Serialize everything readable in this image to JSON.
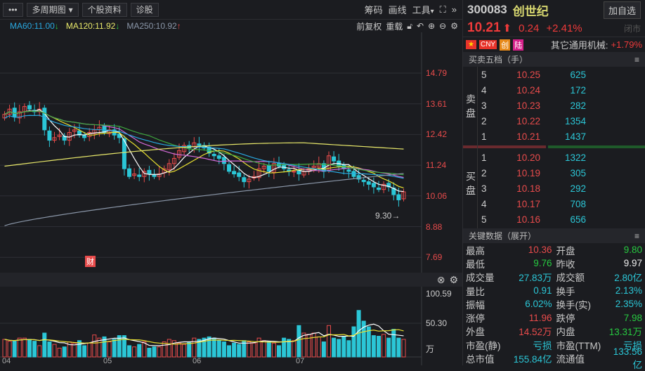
{
  "toolbar": {
    "more": "•••",
    "multi_period": "多周期图",
    "profile": "个股资料",
    "diagnose": "诊股",
    "chips": "筹码",
    "draw": "画线",
    "tools": "工具"
  },
  "ma_legend": [
    {
      "label": "MA60:11.00",
      "arrow": "↓",
      "color": "#29a8e0"
    },
    {
      "label": "MA120:11.92",
      "arrow": "↓",
      "color": "#e8e86a"
    },
    {
      "label": "MA250:10.92",
      "arrow": "↑",
      "color": "#8a96a8"
    }
  ],
  "chart_tools": {
    "adjust": "前复权",
    "reload": "重载"
  },
  "price_axis": [
    "14.79",
    "13.61",
    "12.42",
    "11.24",
    "10.06",
    "8.88",
    "7.69"
  ],
  "volume_axis": [
    "100.59",
    "50.30",
    "万"
  ],
  "date_axis": [
    "04",
    "05",
    "06",
    "07"
  ],
  "annotations": {
    "low_marker": "9.30→",
    "finance_badge": "财"
  },
  "chart_data": {
    "type": "candlestick",
    "closes": [
      13.2,
      13.4,
      13.1,
      13.3,
      13.5,
      13.4,
      13.3,
      13.4,
      12.6,
      12.2,
      12.3,
      12.4,
      12.2,
      12.5,
      12.6,
      12.4,
      12.3,
      12.5,
      12.6,
      12.7,
      12.5,
      12.6,
      12.4,
      12.3,
      11.1,
      10.8,
      10.9,
      10.8,
      11.0,
      10.9,
      10.8,
      10.9,
      11.1,
      11.3,
      11.5,
      11.8,
      12.0,
      11.9,
      12.1,
      12.0,
      11.9,
      11.7,
      11.6,
      11.5,
      11.3,
      11.0,
      10.9,
      10.8,
      10.6,
      10.7,
      10.8,
      11.1,
      11.2,
      11.0,
      11.3,
      11.2,
      11.1,
      11.0,
      11.0,
      10.9,
      11.0,
      11.1,
      11.2,
      11.3,
      11.0,
      11.6,
      11.4,
      11.2,
      11.1,
      11.0,
      10.8,
      10.7,
      10.6,
      10.5,
      10.4,
      10.3,
      10.5,
      10.4,
      10.1,
      9.9,
      10.21
    ],
    "volumes": [
      28,
      25,
      25,
      30,
      30,
      28,
      25,
      18,
      38,
      24,
      20,
      14,
      16,
      24,
      22,
      26,
      18,
      22,
      35,
      30,
      32,
      24,
      28,
      34,
      34,
      18,
      16,
      20,
      24,
      14,
      16,
      16,
      24,
      28,
      26,
      22,
      20,
      24,
      30,
      28,
      30,
      32,
      30,
      26,
      24,
      18,
      22,
      20,
      26,
      24,
      22,
      30,
      26,
      24,
      22,
      18,
      30,
      28,
      26,
      50,
      38,
      36,
      38,
      32,
      24,
      50,
      30,
      28,
      32,
      26,
      48,
      74,
      57,
      48,
      34,
      33,
      36,
      30,
      44,
      30,
      28,
      32,
      30
    ],
    "price_range": [
      7.69,
      14.79
    ],
    "volume_range": [
      0,
      100.59
    ],
    "colors": {
      "up": "#e84b4b",
      "down": "#2bc6d6",
      "ma5": "#ffffff",
      "ma10": "#e8e030",
      "ma20": "#d36ad6",
      "ma30": "#3fa83f",
      "ma60": "#29a8e0",
      "ma120": "#e8e86a",
      "ma250": "#8a96a8"
    }
  },
  "stock": {
    "code": "300083",
    "name": "创世纪",
    "add_watch": "加自选",
    "price": "10.21",
    "change": "0.24",
    "pct": "+2.41%",
    "status": "闭市",
    "tags": [
      "CNY",
      "创",
      "陆"
    ],
    "sector": "其它通用机械:",
    "sector_pct": "+1.79%"
  },
  "orderbook": {
    "title": "买卖五档（手）",
    "sell_label": "卖盘",
    "buy_label": "买盘",
    "sell": [
      {
        "lv": "5",
        "p": "10.25",
        "v": "625"
      },
      {
        "lv": "4",
        "p": "10.24",
        "v": "172"
      },
      {
        "lv": "3",
        "p": "10.23",
        "v": "282"
      },
      {
        "lv": "2",
        "p": "10.22",
        "v": "1354"
      },
      {
        "lv": "1",
        "p": "10.21",
        "v": "1437"
      }
    ],
    "buy": [
      {
        "lv": "1",
        "p": "10.20",
        "v": "1322"
      },
      {
        "lv": "2",
        "p": "10.19",
        "v": "305"
      },
      {
        "lv": "3",
        "p": "10.18",
        "v": "292"
      },
      {
        "lv": "4",
        "p": "10.17",
        "v": "708"
      },
      {
        "lv": "5",
        "p": "10.16",
        "v": "656"
      }
    ]
  },
  "keydata": {
    "title": "关键数据（展开）",
    "rows": [
      [
        {
          "k": "最高",
          "v": "10.36",
          "c": "red"
        },
        {
          "k": "开盘",
          "v": "9.80",
          "c": "grn"
        }
      ],
      [
        {
          "k": "最低",
          "v": "9.76",
          "c": "grn"
        },
        {
          "k": "昨收",
          "v": "9.97",
          "c": "wht"
        }
      ],
      [
        {
          "k": "成交量",
          "v": "27.83万",
          "c": "cyn"
        },
        {
          "k": "成交额",
          "v": "2.80亿",
          "c": "cyn"
        }
      ],
      [
        {
          "k": "量比",
          "v": "0.91",
          "c": "cyn"
        },
        {
          "k": "换手",
          "v": "2.13%",
          "c": "cyn"
        }
      ],
      [
        {
          "k": "振幅",
          "v": "6.02%",
          "c": "cyn"
        },
        {
          "k": "换手(实)",
          "v": "2.35%",
          "c": "cyn"
        }
      ],
      [
        {
          "k": "涨停",
          "v": "11.96",
          "c": "red"
        },
        {
          "k": "跌停",
          "v": "7.98",
          "c": "grn"
        }
      ],
      [
        {
          "k": "外盘",
          "v": "14.52万",
          "c": "red"
        },
        {
          "k": "内盘",
          "v": "13.31万",
          "c": "grn"
        }
      ],
      [
        {
          "k": "市盈(静)",
          "v": "亏损",
          "c": "cyn"
        },
        {
          "k": "市盈(TTM)",
          "v": "亏损",
          "c": "cyn"
        }
      ],
      [
        {
          "k": "总市值",
          "v": "155.84亿",
          "c": "cyn"
        },
        {
          "k": "流通值",
          "v": "133.56亿",
          "c": "cyn"
        }
      ]
    ]
  }
}
